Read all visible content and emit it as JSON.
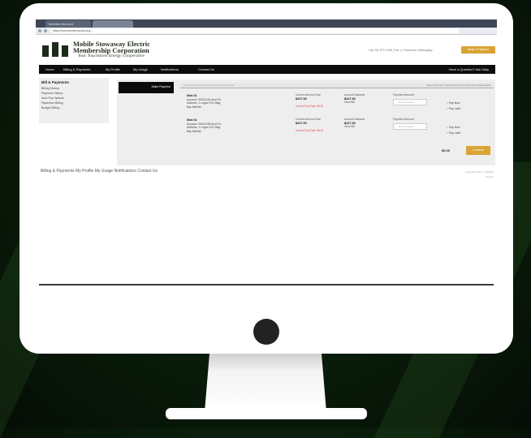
{
  "browser": {
    "tab1": "Member Account",
    "tab2": "",
    "url": "https://mewmemberportal.org/..."
  },
  "site": {
    "company_line1": "Mobile Stowaway Electric",
    "company_line2": "Membership Corporation",
    "tagline": "Your Touchstone Energy Cooperative",
    "header_links": "Call 251-579-7005 | Fax 1 | Facebook | Messaging",
    "pay_button": "Make a Payment"
  },
  "nav": {
    "items": [
      "Home",
      "Billing & Payments",
      "My Profile",
      "My Usage",
      "Notifications",
      "Contact Us"
    ],
    "right": "Have a Question? Ask Sally"
  },
  "sidebar": {
    "heading": "Bill & Payments",
    "links": [
      "Billing History",
      "Payment History",
      "Auto Pay Options",
      "Paperless Billing",
      "Budget Billing"
    ]
  },
  "panel": {
    "tab_label": "Make Payment",
    "bar_left": "Enter payment amount for each account below",
    "bar_right": "Select payment method and confirm payment details below"
  },
  "accounts": [
    {
      "name": "Main St.",
      "line1": "Account: 00001234   Acct Ph:",
      "line2": "Address: 1 Legion Rd, Bldg",
      "line3": "Bay Minette",
      "due_label": "Current Amount Due",
      "due_value": "$227.90",
      "due_note": "Current Due Date 08/15",
      "acct_bal_label": "Account Balance",
      "acct_bal_value": "$227.90",
      "view_bill": "View Bill",
      "pay_label": "Payment Amount",
      "pay_placeholder": "Enter Amount",
      "opt1": "Pay Now",
      "opt2": "Pay Later"
    },
    {
      "name": "Main St.",
      "line1": "Account: 00001235   Acct Ph:",
      "line2": "Address: 1 Legion Rd, Bldg",
      "line3": "Bay Minette",
      "due_label": "Current Amount Due",
      "due_value": "$227.90",
      "due_note": "Current Due Date 08/15",
      "acct_bal_label": "Account Balance",
      "acct_bal_value": "$227.90",
      "view_bill": "View Bill",
      "pay_label": "Payment Amount",
      "pay_placeholder": "Enter Amount",
      "opt1": "Pay Now",
      "opt2": "Pay Later"
    }
  ],
  "summary": {
    "total": "$0.00",
    "continue": "Continue"
  },
  "footer": {
    "nav": "Billing & Payments   My Profile   My Usage   Notifications   Contact Us",
    "copyright_line1": "Copyright 2019 © MSEMC",
    "copyright_line2": "Privacy"
  },
  "colors": {
    "accent_gold": "#d9a435",
    "nav_black": "#0d0d0d",
    "background_green": "#0a1f0b"
  }
}
